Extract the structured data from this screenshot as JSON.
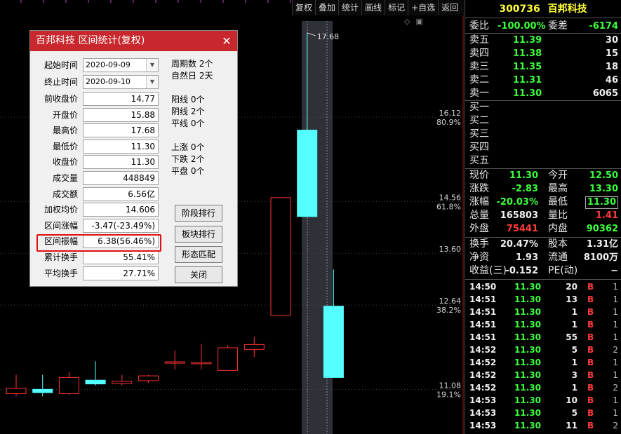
{
  "toolbar": {
    "items": [
      "复权",
      "叠加",
      "统计",
      "画线",
      "标记",
      "+自选",
      "返回"
    ]
  },
  "chart": {
    "price_labels": [
      {
        "price": "16.12",
        "pct": "80.9%"
      },
      {
        "price": "14.56",
        "pct": "61.8%"
      },
      {
        "price": "13.60",
        "pct": ""
      },
      {
        "price": "12.64",
        "pct": "38.2%"
      },
      {
        "price": "11.08",
        "pct": "19.1%"
      }
    ],
    "high_annotation": "17.68",
    "colors": {
      "up": "#ff3232",
      "down": "#54ffff",
      "grid": "#882222",
      "bg": "#000000"
    }
  },
  "chart_data": {
    "type": "candlestick",
    "candles": [
      {
        "open": 11.0,
        "close": 11.1,
        "high": 11.35,
        "low": 10.95,
        "dir": "up"
      },
      {
        "open": 11.08,
        "close": 11.02,
        "high": 11.35,
        "low": 10.95,
        "dir": "down"
      },
      {
        "open": 11.0,
        "close": 11.3,
        "high": 11.4,
        "low": 10.98,
        "dir": "up"
      },
      {
        "open": 11.25,
        "close": 11.18,
        "high": 11.6,
        "low": 11.15,
        "dir": "down"
      },
      {
        "open": 11.19,
        "close": 11.23,
        "high": 11.35,
        "low": 11.15,
        "dir": "up"
      },
      {
        "open": 11.24,
        "close": 11.33,
        "high": 11.35,
        "low": 11.2,
        "dir": "up"
      },
      {
        "open": 11.57,
        "close": 11.59,
        "high": 11.8,
        "low": 11.45,
        "dir": "up"
      },
      {
        "open": 11.56,
        "close": 11.58,
        "high": 11.92,
        "low": 11.45,
        "dir": "up"
      },
      {
        "open": 11.43,
        "close": 11.85,
        "high": 11.9,
        "low": 11.42,
        "dir": "up"
      },
      {
        "open": 11.82,
        "close": 11.91,
        "high": 12.05,
        "low": 11.68,
        "dir": "up"
      },
      {
        "open": 12.45,
        "close": 14.63,
        "high": 14.63,
        "low": 12.45,
        "dir": "up"
      },
      {
        "open": 15.88,
        "close": 14.28,
        "high": 17.68,
        "low": 14.28,
        "dir": "down"
      },
      {
        "open": 12.62,
        "close": 11.3,
        "high": 13.3,
        "low": 11.3,
        "dir": "down"
      }
    ],
    "ylim": [
      10.5,
      17.9
    ]
  },
  "dialog": {
    "title": "百邦科技 区间统计(复权)",
    "fields": [
      {
        "label": "起始时间",
        "value": "2020-09-09",
        "kind": "date"
      },
      {
        "label": "终止时间",
        "value": "2020-09-10",
        "kind": "date"
      },
      {
        "label": "前收盘价",
        "value": "14.77"
      },
      {
        "label": "开盘价",
        "value": "15.88"
      },
      {
        "label": "最高价",
        "value": "17.68"
      },
      {
        "label": "最低价",
        "value": "11.30"
      },
      {
        "label": "收盘价",
        "value": "11.30"
      },
      {
        "label": "成交量",
        "value": "448849"
      },
      {
        "label": "成交额",
        "value": "6.56亿"
      },
      {
        "label": "加权均价",
        "value": "14.606"
      },
      {
        "label": "区间涨幅",
        "value": "-3.47(-23.49%)"
      },
      {
        "label": "区间振幅",
        "value": "6.38(56.46%)"
      },
      {
        "label": "累计换手",
        "value": "55.41%"
      },
      {
        "label": "平均换手",
        "value": "27.71%"
      }
    ],
    "stats": [
      "周期数 2个",
      "自然日 2天",
      "阳线 0个",
      "阴线 2个",
      "平线 0个",
      "上涨 0个",
      "下跌 2个",
      "平盘 0个"
    ],
    "buttons": [
      "阶段排行",
      "板块排行",
      "形态匹配",
      "关闭"
    ],
    "close_glyph": "✕"
  },
  "quote": {
    "code": "300736",
    "name": "百邦科技",
    "weibi_label": "委比",
    "weibi": "-100.00%",
    "weicha_label": "委差",
    "weicha": "-6174",
    "asks": [
      {
        "label": "卖五",
        "price": "11.39",
        "vol": "30"
      },
      {
        "label": "卖四",
        "price": "11.38",
        "vol": "15"
      },
      {
        "label": "卖三",
        "price": "11.35",
        "vol": "18"
      },
      {
        "label": "卖二",
        "price": "11.31",
        "vol": "46"
      },
      {
        "label": "卖一",
        "price": "11.30",
        "vol": "6065"
      }
    ],
    "bids": [
      {
        "label": "买一"
      },
      {
        "label": "买二"
      },
      {
        "label": "买三"
      },
      {
        "label": "买四"
      },
      {
        "label": "买五"
      }
    ],
    "stats": [
      {
        "l1": "现价",
        "v1": "11.30",
        "c1": "down",
        "l2": "今开",
        "v2": "12.50",
        "c2": "down"
      },
      {
        "l1": "涨跌",
        "v1": "-2.83",
        "c1": "down",
        "l2": "最高",
        "v2": "13.30",
        "c2": "down"
      },
      {
        "l1": "涨幅",
        "v1": "-20.03%",
        "c1": "down",
        "l2": "最低",
        "v2": "11.30",
        "c2": "down",
        "boxed": true
      },
      {
        "l1": "总量",
        "v1": "165803",
        "c1": "white",
        "l2": "量比",
        "v2": "1.41",
        "c2": "up"
      },
      {
        "l1": "外盘",
        "v1": "75441",
        "c1": "up",
        "l2": "内盘",
        "v2": "90362",
        "c2": "down"
      },
      {
        "l1": "换手",
        "v1": "20.47%",
        "c1": "white",
        "l2": "股本",
        "v2": "1.31亿",
        "c2": "white"
      },
      {
        "l1": "净资",
        "v1": "1.93",
        "c1": "white",
        "l2": "流通",
        "v2": "8100万",
        "c2": "white"
      },
      {
        "l1": "收益(三)",
        "v1": "-0.152",
        "c1": "white",
        "l2": "PE(动)",
        "v2": "−",
        "c2": "white"
      }
    ],
    "ticks": [
      {
        "time": "14:50",
        "price": "11.30",
        "vol": "20",
        "side": "B",
        "n": "1"
      },
      {
        "time": "14:51",
        "price": "11.30",
        "vol": "13",
        "side": "B",
        "n": "1"
      },
      {
        "time": "14:51",
        "price": "11.30",
        "vol": "1",
        "side": "B",
        "n": "1"
      },
      {
        "time": "14:51",
        "price": "11.30",
        "vol": "1",
        "side": "B",
        "n": "1"
      },
      {
        "time": "14:51",
        "price": "11.30",
        "vol": "55",
        "side": "B",
        "n": "1"
      },
      {
        "time": "14:52",
        "price": "11.30",
        "vol": "5",
        "side": "B",
        "n": "2"
      },
      {
        "time": "14:52",
        "price": "11.30",
        "vol": "1",
        "side": "B",
        "n": "1"
      },
      {
        "time": "14:52",
        "price": "11.30",
        "vol": "3",
        "side": "B",
        "n": "1"
      },
      {
        "time": "14:52",
        "price": "11.30",
        "vol": "1",
        "side": "B",
        "n": "2"
      },
      {
        "time": "14:53",
        "price": "11.30",
        "vol": "10",
        "side": "B",
        "n": "1"
      },
      {
        "time": "14:53",
        "price": "11.30",
        "vol": "5",
        "side": "B",
        "n": "1"
      },
      {
        "time": "14:53",
        "price": "11.30",
        "vol": "11",
        "side": "B",
        "n": "2"
      }
    ]
  }
}
